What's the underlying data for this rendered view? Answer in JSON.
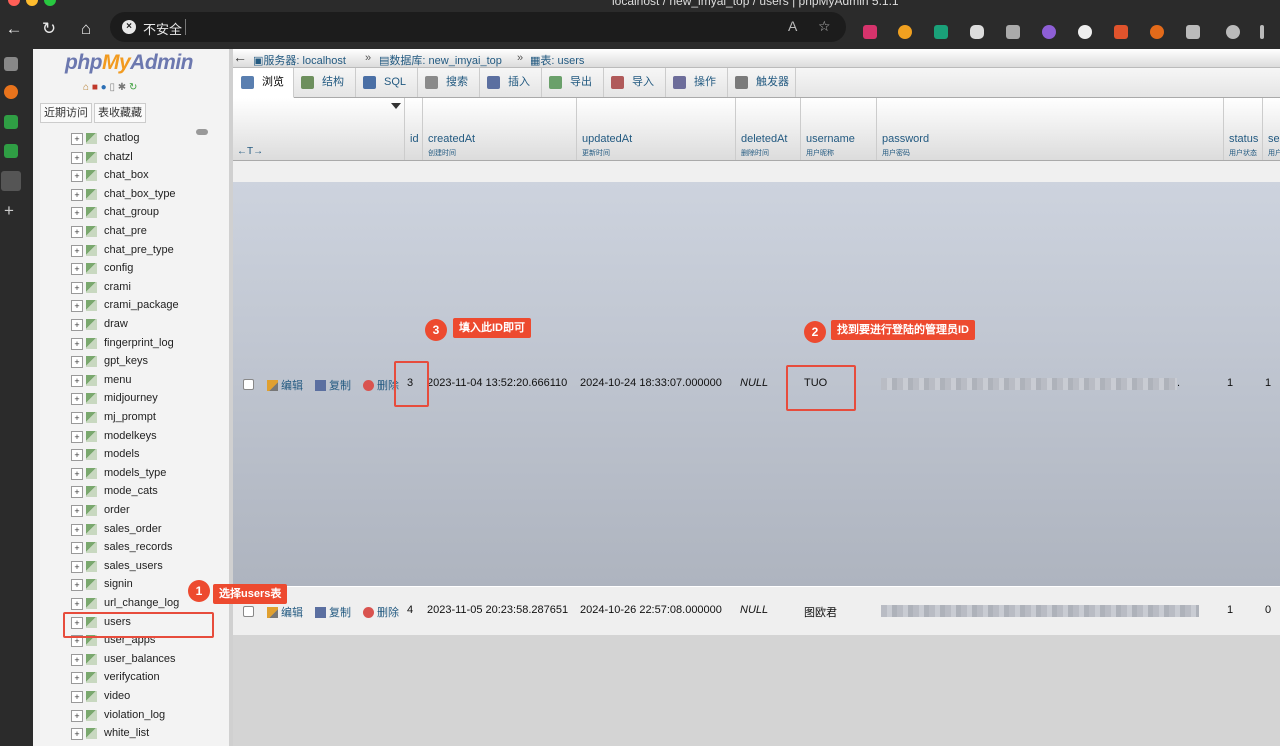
{
  "browser": {
    "window_title": "localhost / new_imyai_top / users | phpMyAdmin 5.1.1",
    "security_label": "不安全"
  },
  "pma": {
    "logo_php": "php",
    "logo_my": "My",
    "logo_admin": "Admin",
    "recent_button": "近期访问",
    "favorites_button": "表收藏藏",
    "tables": [
      "chatlog",
      "chatzl",
      "chat_box",
      "chat_box_type",
      "chat_group",
      "chat_pre",
      "chat_pre_type",
      "config",
      "crami",
      "crami_package",
      "draw",
      "fingerprint_log",
      "gpt_keys",
      "menu",
      "midjourney",
      "mj_prompt",
      "modelkeys",
      "models",
      "models_type",
      "mode_cats",
      "order",
      "sales_order",
      "sales_records",
      "sales_users",
      "signin",
      "url_change_log",
      "users",
      "user_apps",
      "user_balances",
      "verifycation",
      "video",
      "violation_log",
      "white_list"
    ]
  },
  "breadcrumb": {
    "server_label": "服务器:",
    "server_value": "localhost",
    "db_label": "数据库:",
    "db_value": "new_imyai_top",
    "table_label": "表:",
    "table_value": "users"
  },
  "tabs": [
    "浏览",
    "结构",
    "SQL",
    "搜索",
    "插入",
    "导出",
    "导入",
    "操作",
    "触发器"
  ],
  "table": {
    "col_control": "←T→",
    "columns": [
      {
        "name": "id",
        "comment": ""
      },
      {
        "name": "createdAt",
        "comment": "创建时间"
      },
      {
        "name": "updatedAt",
        "comment": "更新时间"
      },
      {
        "name": "deletedAt",
        "comment": "删除时间"
      },
      {
        "name": "username",
        "comment": "用户昵称"
      },
      {
        "name": "password",
        "comment": "用户密码"
      },
      {
        "name": "status",
        "comment": "用户状态"
      },
      {
        "name": "sex",
        "comment": "用户性别"
      }
    ],
    "actions": {
      "edit": "编辑",
      "copy": "复制",
      "delete": "删除"
    },
    "rows": [
      {
        "id": "3",
        "createdAt": "2023-11-04 13:52:20.666110",
        "updatedAt": "2024-10-24 18:33:07.000000",
        "deletedAt": "NULL",
        "username": "TUO",
        "password_tail": ".",
        "status": "1",
        "sex": "1"
      },
      {
        "id": "4",
        "createdAt": "2023-11-05 20:23:58.287651",
        "updatedAt": "2024-10-26 22:57:08.000000",
        "deletedAt": "NULL",
        "username": "图欧君",
        "password_tail": "",
        "status": "1",
        "sex": "0"
      }
    ]
  },
  "annotations": {
    "step1": {
      "num": "1",
      "text": "选择users表"
    },
    "step2": {
      "num": "2",
      "text": "找到要进行登陆的管理员ID"
    },
    "step3": {
      "num": "3",
      "text": "填入此ID即可"
    }
  },
  "colors": {
    "accent": "#ed4a2f",
    "link": "#235a81",
    "logo_blue": "#6c78af",
    "logo_orange": "#f29b20"
  }
}
